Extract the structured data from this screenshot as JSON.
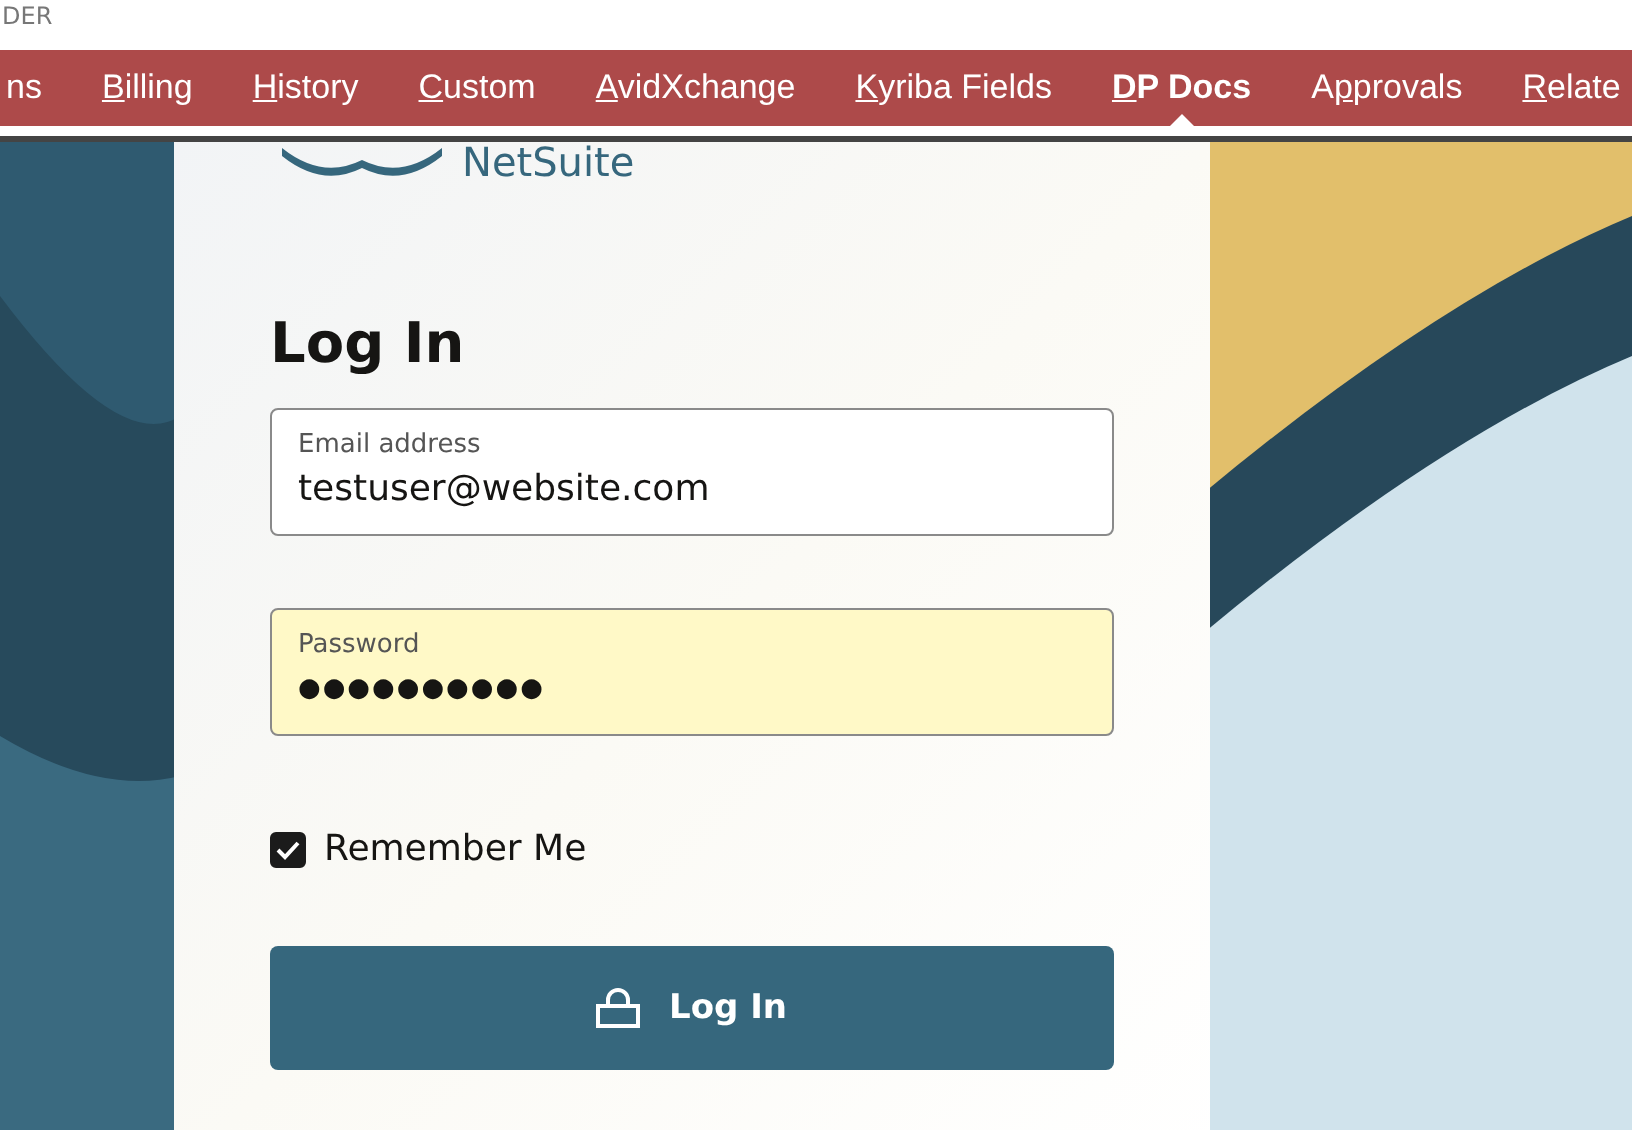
{
  "header": {
    "cut_text": "DER"
  },
  "tabs": [
    {
      "before": "ns",
      "selected": false
    },
    {
      "hotkey": "B",
      "after": "illing",
      "selected": false
    },
    {
      "hotkey": "H",
      "after": "istory",
      "selected": false
    },
    {
      "hotkey": "C",
      "after": "ustom",
      "selected": false
    },
    {
      "hotkey": "A",
      "after": "vidXchange",
      "selected": false
    },
    {
      "hotkey": "K",
      "after": "yriba Fields",
      "selected": false
    },
    {
      "hotkey": "D",
      "after": "P Docs",
      "selected": true
    },
    {
      "before": "A",
      "hotkey": "p",
      "after": "provals",
      "selected": false
    },
    {
      "hotkey": "R",
      "after": "elate",
      "selected": false
    }
  ],
  "login": {
    "logo": "NetSuite",
    "title": "Log In",
    "fields": [
      {
        "label": "Email address",
        "value": "testuser@website.com",
        "kind": "text",
        "autofilled": false
      },
      {
        "label": "Password",
        "value": "●●●●●●●●●●",
        "kind": "password",
        "autofilled": true
      }
    ],
    "remember": {
      "label": "Remember Me",
      "checked": true
    },
    "button": "Log In"
  }
}
